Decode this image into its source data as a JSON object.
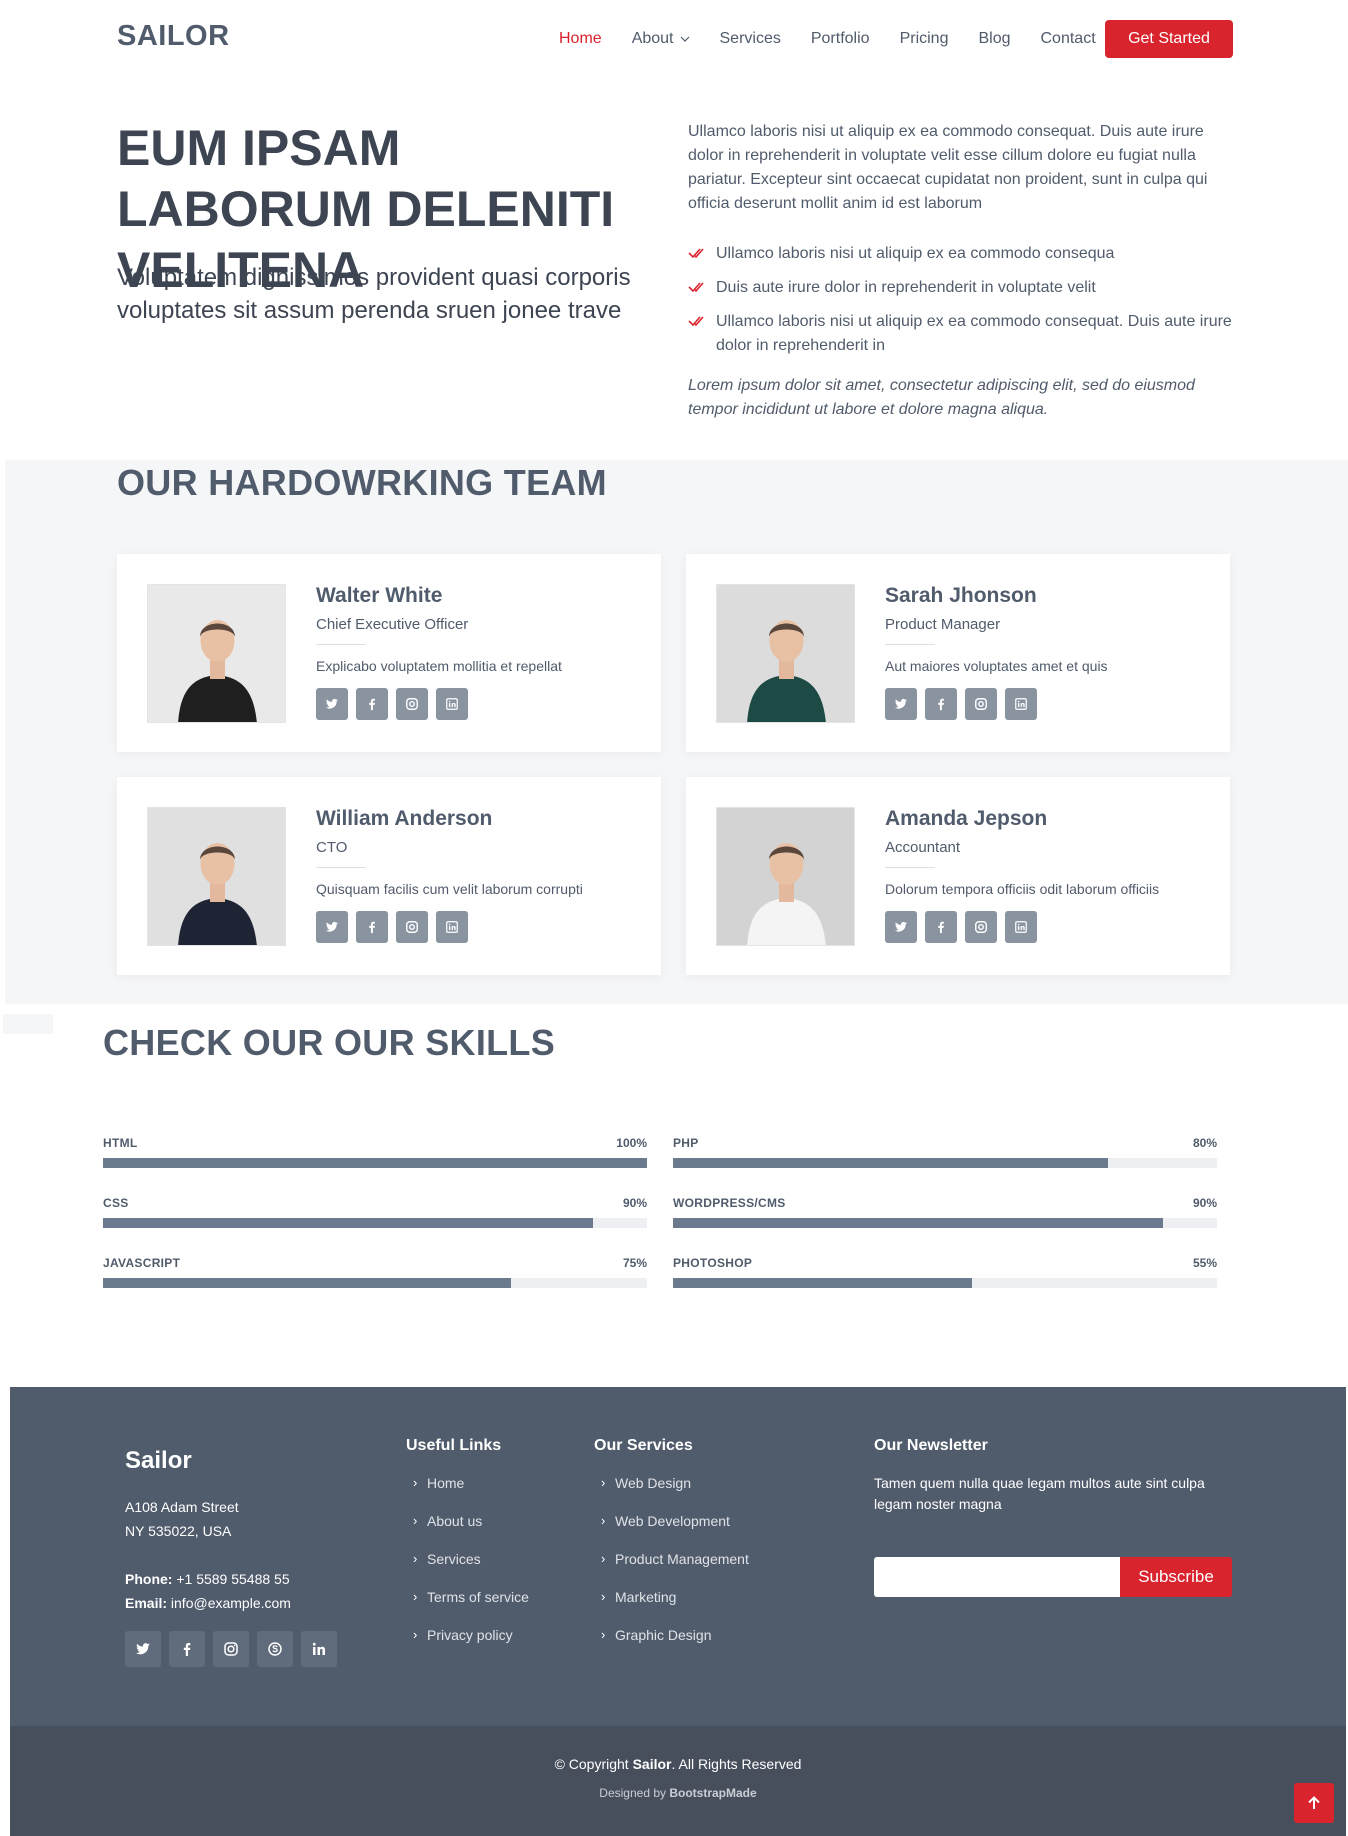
{
  "header": {
    "logo": "SAILOR",
    "nav": [
      "Home",
      "About",
      "Services",
      "Portfolio",
      "Pricing",
      "Blog",
      "Contact"
    ],
    "cta": "Get Started"
  },
  "hero": {
    "title": "EUM IPSAM LABORUM DELENITI VELITENA",
    "subtitle": "Voluptatem dignissimos provident quasi corporis voluptates sit assum perenda sruen jonee trave",
    "paragraph": "Ullamco laboris nisi ut aliquip ex ea commodo consequat. Duis aute irure dolor in reprehenderit in voluptate velit esse cillum dolore eu fugiat nulla pariatur. Excepteur sint occaecat cupidatat non proident, sunt in culpa qui officia deserunt mollit anim id est laborum",
    "list": [
      "Ullamco laboris nisi ut aliquip ex ea commodo consequa",
      "Duis aute irure dolor in reprehenderit in voluptate velit",
      "Ullamco laboris nisi ut aliquip ex ea commodo consequat. Duis aute irure dolor in reprehenderit in"
    ],
    "italic": "Lorem ipsum dolor sit amet, consectetur adipiscing elit, sed do eiusmod tempor incididunt ut labore et dolore magna aliqua."
  },
  "team": {
    "title": "OUR HARDOWRKING TEAM",
    "members": [
      {
        "name": "Walter White",
        "role": "Chief Executive Officer",
        "desc": "Explicabo voluptatem mollitia et repellat"
      },
      {
        "name": "Sarah Jhonson",
        "role": "Product Manager",
        "desc": "Aut maiores voluptates amet et quis"
      },
      {
        "name": "William Anderson",
        "role": "CTO",
        "desc": "Quisquam facilis cum velit laborum corrupti"
      },
      {
        "name": "Amanda Jepson",
        "role": "Accountant",
        "desc": "Dolorum tempora officiis odit laborum officiis"
      }
    ],
    "social_icons": [
      "twitter-icon",
      "facebook-icon",
      "instagram-icon",
      "linkedin-icon"
    ]
  },
  "skills": {
    "title": "CHECK OUR OUR SKILLS",
    "items": [
      {
        "label": "HTML",
        "value": "100%",
        "percent": 100
      },
      {
        "label": "PHP",
        "value": "80%",
        "percent": 80
      },
      {
        "label": "CSS",
        "value": "90%",
        "percent": 90
      },
      {
        "label": "WORDPRESS/CMS",
        "value": "90%",
        "percent": 90
      },
      {
        "label": "JAVASCRIPT",
        "value": "75%",
        "percent": 75
      },
      {
        "label": "PHOTOSHOP",
        "value": "55%",
        "percent": 55
      }
    ]
  },
  "footer": {
    "brand": "Sailor",
    "address_line1": "A108 Adam Street",
    "address_line2": "NY 535022, USA",
    "phone_label": "Phone:",
    "phone": "+1 5589 55488 55",
    "email_label": "Email:",
    "email": "info@example.com",
    "useful_links_title": "Useful Links",
    "useful_links": [
      "Home",
      "About us",
      "Services",
      "Terms of service",
      "Privacy policy"
    ],
    "services_title": "Our Services",
    "services": [
      "Web Design",
      "Web Development",
      "Product Management",
      "Marketing",
      "Graphic Design"
    ],
    "newsletter_title": "Our Newsletter",
    "newsletter_text": "Tamen quem nulla quae legam multos aute sint culpa legam noster magna",
    "subscribe": "Subscribe",
    "social_icons": [
      "twitter-icon",
      "facebook-icon",
      "instagram-icon",
      "skype-icon",
      "linkedin-icon"
    ]
  },
  "bottom": {
    "copyright_prefix": "© Copyright ",
    "copyright_brand": "Sailor",
    "copyright_suffix": ". All Rights Reserved",
    "designed_by": "Designed by ",
    "designer": "BootstrapMade"
  },
  "colors": {
    "accent": "#d9232d",
    "primary": "#505b6b",
    "footer": "#505b6b"
  }
}
